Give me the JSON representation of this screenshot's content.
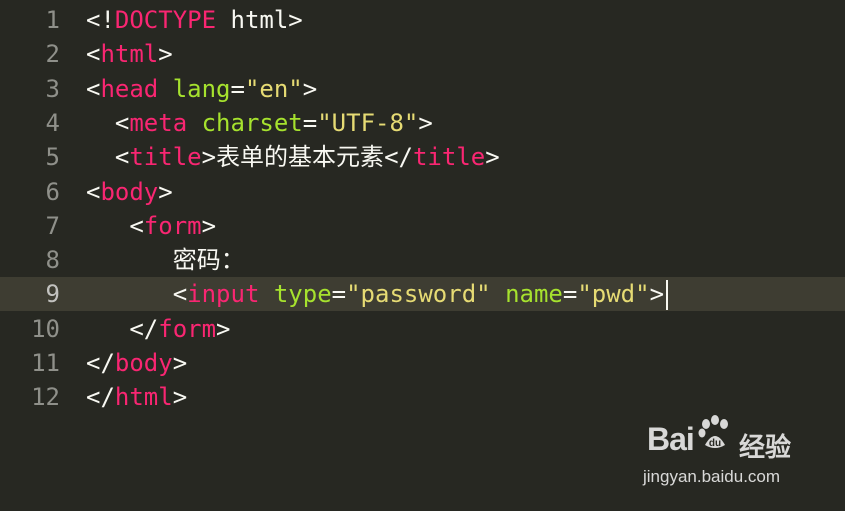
{
  "editor": {
    "theme_colors": {
      "background": "#272822",
      "current_line": "#3e3d32",
      "tag": "#f92672",
      "attribute": "#a6e22e",
      "string": "#e6db74",
      "text": "#f8f8f2",
      "gutter": "#8f908a"
    },
    "current_line": 9,
    "lines": [
      {
        "num": "1",
        "tokens": [
          {
            "t": "<!",
            "c": "plain"
          },
          {
            "t": "DOCTYPE",
            "c": "tag"
          },
          {
            "t": " html>",
            "c": "plain"
          }
        ]
      },
      {
        "num": "2",
        "tokens": [
          {
            "t": "<",
            "c": "plain"
          },
          {
            "t": "html",
            "c": "tag"
          },
          {
            "t": ">",
            "c": "plain"
          }
        ]
      },
      {
        "num": "3",
        "tokens": [
          {
            "t": "<",
            "c": "plain"
          },
          {
            "t": "head",
            "c": "tag"
          },
          {
            "t": " ",
            "c": "plain"
          },
          {
            "t": "lang",
            "c": "attr"
          },
          {
            "t": "=",
            "c": "plain"
          },
          {
            "t": "\"en\"",
            "c": "str"
          },
          {
            "t": ">",
            "c": "plain"
          }
        ]
      },
      {
        "num": "4",
        "tokens": [
          {
            "t": "  <",
            "c": "plain"
          },
          {
            "t": "meta",
            "c": "tag"
          },
          {
            "t": " ",
            "c": "plain"
          },
          {
            "t": "charset",
            "c": "attr"
          },
          {
            "t": "=",
            "c": "plain"
          },
          {
            "t": "\"UTF-8\"",
            "c": "str"
          },
          {
            "t": ">",
            "c": "plain"
          }
        ]
      },
      {
        "num": "5",
        "tokens": [
          {
            "t": "  <",
            "c": "plain"
          },
          {
            "t": "title",
            "c": "tag"
          },
          {
            "t": ">",
            "c": "plain"
          },
          {
            "t": "表单的基本元素",
            "c": "cjk"
          },
          {
            "t": "</",
            "c": "plain"
          },
          {
            "t": "title",
            "c": "tag"
          },
          {
            "t": ">",
            "c": "plain"
          }
        ]
      },
      {
        "num": "6",
        "tokens": [
          {
            "t": "<",
            "c": "plain"
          },
          {
            "t": "body",
            "c": "tag"
          },
          {
            "t": ">",
            "c": "plain"
          }
        ]
      },
      {
        "num": "7",
        "tokens": [
          {
            "t": "   <",
            "c": "plain"
          },
          {
            "t": "form",
            "c": "tag"
          },
          {
            "t": ">",
            "c": "plain"
          }
        ]
      },
      {
        "num": "8",
        "tokens": [
          {
            "t": "      ",
            "c": "plain"
          },
          {
            "t": "密码：",
            "c": "cjk"
          }
        ]
      },
      {
        "num": "9",
        "tokens": [
          {
            "t": "      <",
            "c": "plain"
          },
          {
            "t": "input",
            "c": "tag"
          },
          {
            "t": " ",
            "c": "plain"
          },
          {
            "t": "type",
            "c": "attr"
          },
          {
            "t": "=",
            "c": "plain"
          },
          {
            "t": "\"password\"",
            "c": "str"
          },
          {
            "t": " ",
            "c": "plain"
          },
          {
            "t": "name",
            "c": "attr"
          },
          {
            "t": "=",
            "c": "plain"
          },
          {
            "t": "\"pwd\"",
            "c": "str"
          },
          {
            "t": ">",
            "c": "plain"
          }
        ]
      },
      {
        "num": "10",
        "tokens": [
          {
            "t": "   </",
            "c": "plain"
          },
          {
            "t": "form",
            "c": "tag"
          },
          {
            "t": ">",
            "c": "plain"
          }
        ]
      },
      {
        "num": "11",
        "tokens": [
          {
            "t": "</",
            "c": "plain"
          },
          {
            "t": "body",
            "c": "tag"
          },
          {
            "t": ">",
            "c": "plain"
          }
        ]
      },
      {
        "num": "12",
        "tokens": [
          {
            "t": "</",
            "c": "plain"
          },
          {
            "t": "html",
            "c": "tag"
          },
          {
            "t": ">",
            "c": "plain"
          }
        ]
      }
    ]
  },
  "watermark": {
    "logo_text": "Bai",
    "logo_suffix": "du",
    "brand": "经验",
    "url": "jingyan.baidu.com",
    "icon": "baidu-paw-icon"
  }
}
